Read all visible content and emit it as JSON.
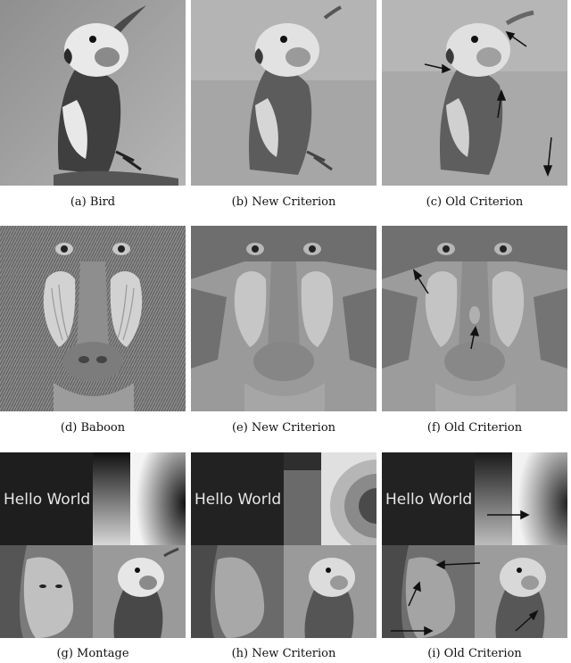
{
  "figure": {
    "captions": [
      "(a) Bird",
      "(b) New Criterion",
      "(c) Old Criterion",
      "(d) Baboon",
      "(e) New Criterion",
      "(f) Old Criterion",
      "(g) Montage",
      "(h) New Criterion",
      "(i) Old Criterion"
    ],
    "montage_text": "Hello World"
  }
}
